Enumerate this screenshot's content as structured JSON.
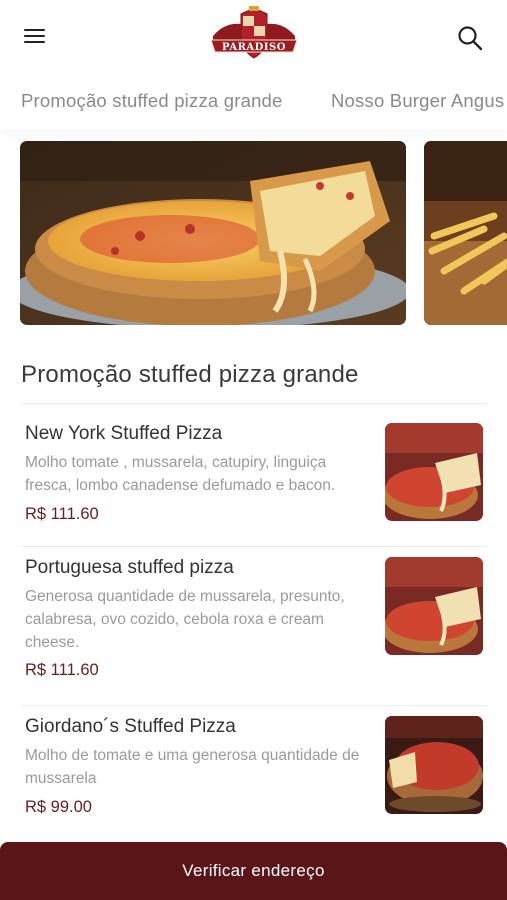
{
  "header": {
    "logo_text": "PARADISO",
    "menu_icon": "hamburger-menu-icon",
    "search_icon": "search-icon"
  },
  "category_tabs": [
    {
      "label": "Promoção stuffed pizza grande"
    },
    {
      "label": "Nosso Burger Angus"
    }
  ],
  "section": {
    "title": "Promoção stuffed pizza grande"
  },
  "products": [
    {
      "name": "New York Stuffed Pizza",
      "description": "Molho tomate , mussarela, catupiry, linguiça fresca, lombo canadense defumado e bacon.",
      "price": "R$ 111.60"
    },
    {
      "name": "Portuguesa stuffed pizza",
      "description": "Generosa quantidade de mussarela, presunto, calabresa, ovo cozido, cebola roxa e cream cheese.",
      "price": "R$ 111.60"
    },
    {
      "name": "Giordano´s Stuffed Pizza",
      "description": "Molho de tomate e uma generosa quantidade de mussarela",
      "price": "R$ 99.00"
    }
  ],
  "cta": {
    "label": "Verificar endereço"
  },
  "colors": {
    "brand": "#5b1418",
    "price": "#6a1d1d",
    "muted_text": "#9a9a9a"
  }
}
